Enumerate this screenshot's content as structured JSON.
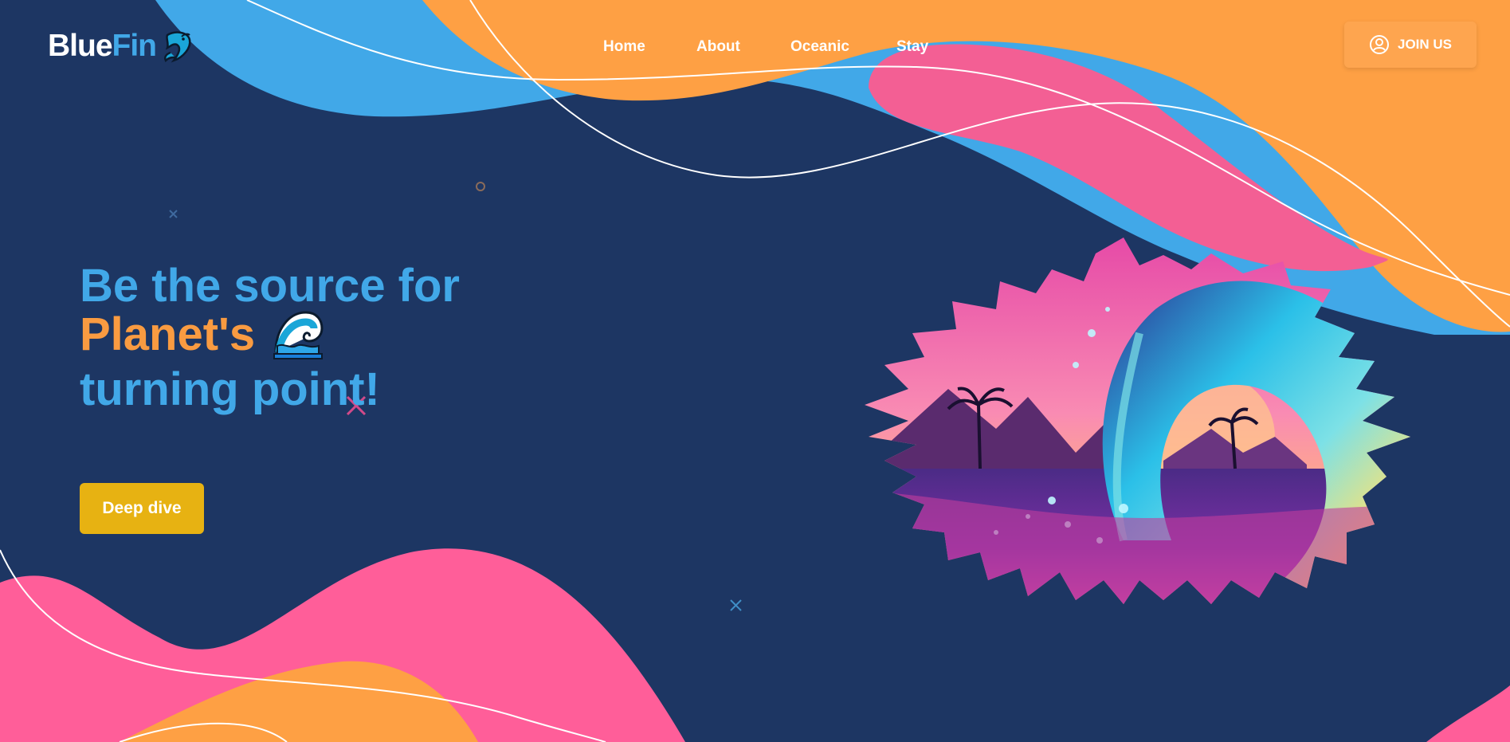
{
  "brand": {
    "part1": "Blue",
    "part2": "Fin",
    "icon": "dolphin-icon"
  },
  "nav": {
    "items": [
      {
        "label": "Home"
      },
      {
        "label": "About"
      },
      {
        "label": "Oceanic"
      },
      {
        "label": "Stay"
      }
    ]
  },
  "join": {
    "label": "JOIN US",
    "icon": "user-circle-icon"
  },
  "hero": {
    "headline_line1": "Be the source for",
    "headline_line2": "Planet's",
    "headline_line3": "turning point!",
    "emoji_icon": "wave-icon",
    "cta_label": "Deep dive",
    "image_icon": "neon-wave-island-artwork"
  },
  "colors": {
    "background": "#1d3663",
    "blue": "#41a8e8",
    "orange": "#f99b41",
    "pink": "#f55e96",
    "cta": "#e7b212"
  }
}
